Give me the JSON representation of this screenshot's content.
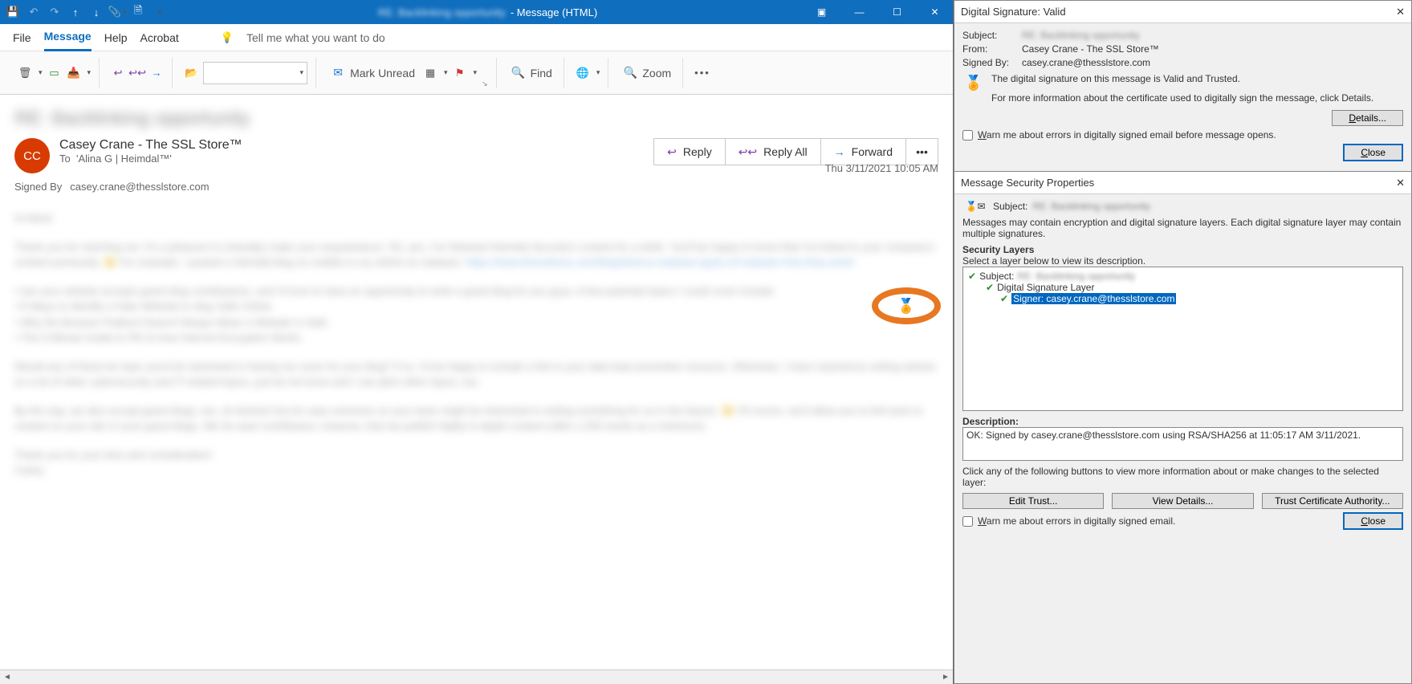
{
  "title_suffix": " - Message (HTML)",
  "title_subject_blur": "RE: Backlinking opportunity",
  "menutabs": {
    "file": "File",
    "message": "Message",
    "help": "Help",
    "acrobat": "Acrobat",
    "tellme": "Tell me what you want to do"
  },
  "ribbon": {
    "mark_unread": "Mark Unread",
    "find": "Find",
    "zoom": "Zoom"
  },
  "header": {
    "subject_blur": "RE: Backlinking opportunity",
    "avatar": "CC",
    "from_name": "Casey Crane - The SSL Store™",
    "to_label": "To",
    "to_value": "'Alina G | Heimdal™'",
    "reply": "Reply",
    "reply_all": "Reply All",
    "forward": "Forward",
    "signed_by_label": "Signed By",
    "signed_by_value": "casey.crane@thesslstore.com",
    "timestamp": "Thu 3/11/2021 10:05 AM"
  },
  "sig_panel": {
    "title": "Digital Signature: Valid",
    "subject_label": "Subject:",
    "subject_blur": "RE: Backlinking opportunity",
    "from_label": "From:",
    "from_value": "Casey Crane - The SSL Store™",
    "signedby_label": "Signed By:",
    "signedby_value": "casey.crane@thesslstore.com",
    "msg1": "The digital signature on this message is Valid and Trusted.",
    "msg2": "For more information about the certificate used to digitally sign the message, click Details.",
    "details_btn": "Details...",
    "warn_chk": "Warn me about errors in digitally signed email before message opens.",
    "close_btn": "Close"
  },
  "sec_panel": {
    "title": "Message Security Properties",
    "subject_label": "Subject:",
    "subject_blur": "RE: Backlinking opportunity",
    "intro": "Messages may contain encryption and digital signature layers. Each digital signature layer may contain multiple signatures.",
    "layers_label": "Security Layers",
    "layers_hint": "Select a layer below to view its description.",
    "tree_subject": "Subject:",
    "tree_subject_blur": "RE: Backlinking opportunity",
    "tree_layer": "Digital Signature Layer",
    "tree_signer": "Signer: casey.crane@thesslstore.com",
    "desc_label": "Description:",
    "desc_value": "OK: Signed by casey.crane@thesslstore.com using RSA/SHA256 at 11:05:17 AM 3/11/2021.",
    "hint2": "Click any of the following buttons to view more information about or make changes to the selected layer:",
    "edit_trust": "Edit Trust...",
    "view_details": "View Details...",
    "trust_ca": "Trust Certificate Authority...",
    "warn_chk": "Warn me about errors in digitally signed email.",
    "close_btn": "Close"
  }
}
